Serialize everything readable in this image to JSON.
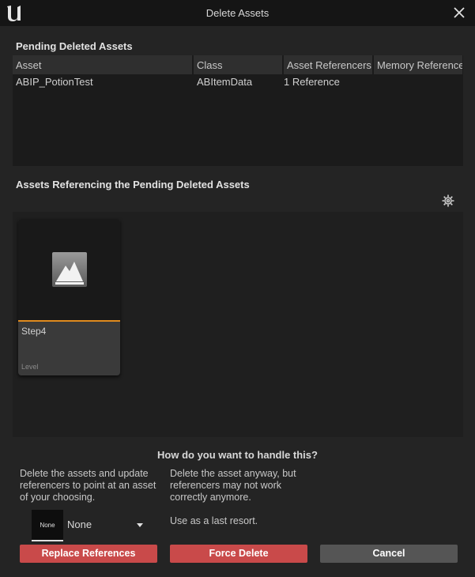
{
  "window": {
    "title": "Delete Assets",
    "logo_icon": "unreal-logo-icon",
    "close_icon": "close-icon"
  },
  "pending": {
    "heading": "Pending Deleted Assets",
    "columns": [
      "Asset",
      "Class",
      "Asset Referencers",
      "Memory References"
    ],
    "rows": [
      {
        "asset": "ABIP_PotionTest",
        "class": "ABItemData",
        "referencers": "1 Reference",
        "memory": ""
      }
    ]
  },
  "referencing": {
    "heading": "Assets Referencing the Pending Deleted Assets",
    "settings_icon": "gear-icon",
    "tiles": [
      {
        "name": "Step4",
        "type": "Level",
        "icon": "level-icon",
        "accent_color": "#e08a1e"
      }
    ]
  },
  "handling": {
    "question": "How do you want to handle this?",
    "replace_desc": "Delete the assets and update referencers to point at an asset of your choosing.",
    "force_desc": "Delete the asset anyway, but referencers may not work correctly anymore.",
    "force_note": "Use as a last resort.",
    "asset_picker": {
      "thumb_text": "None",
      "selected": "None"
    }
  },
  "buttons": {
    "replace": "Replace References",
    "force": "Force Delete",
    "cancel": "Cancel"
  },
  "colors": {
    "danger": "#c94a4a",
    "neutral": "#555555",
    "accent": "#e08a1e"
  }
}
